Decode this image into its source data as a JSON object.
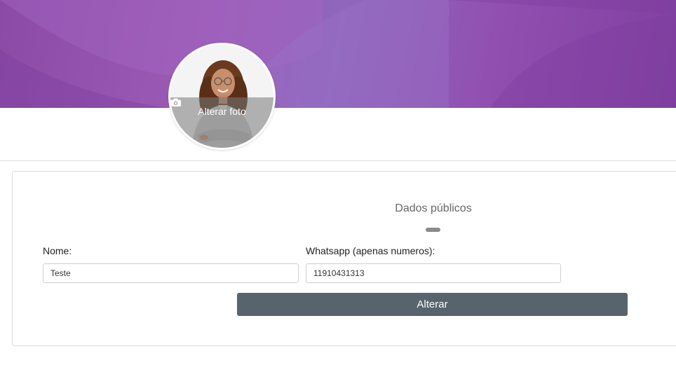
{
  "profile": {
    "change_photo_label": "Alterar foto"
  },
  "form": {
    "title": "Dados públicos",
    "name": {
      "label": "Nome:",
      "value": "Teste"
    },
    "whatsapp": {
      "label": "Whatsapp (apenas numeros):",
      "value": "11910431313"
    },
    "submit_label": "Alterar"
  },
  "icons": {
    "camera": "camera-icon"
  },
  "colors": {
    "cover": "#8f55b0",
    "button": "#57646e"
  }
}
